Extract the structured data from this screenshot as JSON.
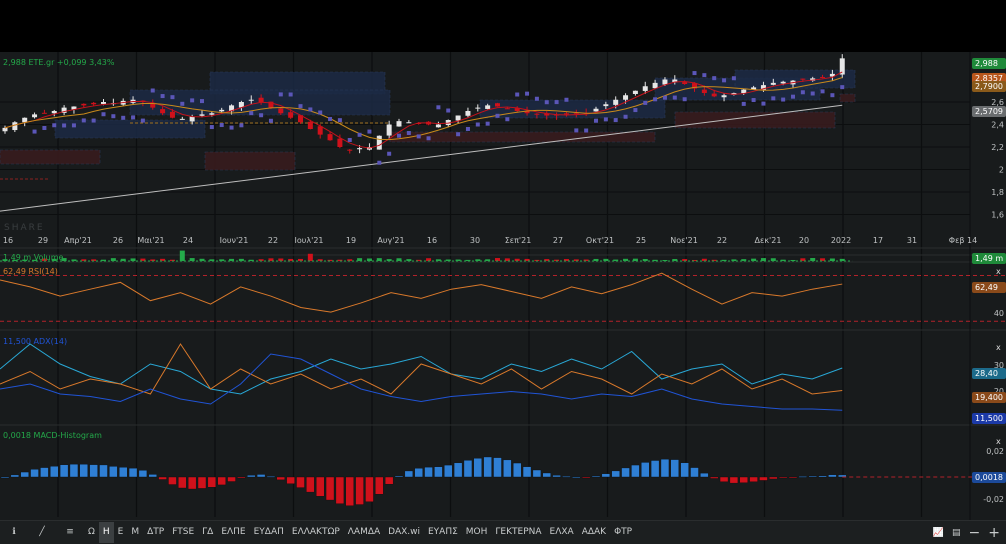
{
  "header": {
    "price": "2,988",
    "symbol": "ETE.gr",
    "change": "+0,099",
    "change_pct": "3,43%"
  },
  "watermark": "SHARE",
  "colors": {
    "up": "#e6e6e6",
    "down": "#d0111b",
    "green": "#24a94a",
    "rsi": "#d9792b",
    "adx_plus": "#29a8d6",
    "adx_minus": "#d9792b",
    "adx": "#2054d6",
    "sar": "#5b56b8",
    "macd_up": "#2f7fd4",
    "macd_down": "#d0111b"
  },
  "right_axis": {
    "price_badges": [
      "2,988",
      "2,8357",
      "2,7900",
      "2,5709"
    ],
    "price_ticks": [
      "2,6",
      "2,4",
      "2,2",
      "2",
      "1,8",
      "1,6"
    ],
    "volume_badge": "1,49 m",
    "rsi_badge": "62,49",
    "rsi_tick": "40",
    "adx_ticks": [
      "30",
      "20"
    ],
    "adx_badges": [
      "28,40",
      "19,400",
      "11,500"
    ],
    "macd_ticks": [
      "0,02",
      "-0,02"
    ],
    "macd_badge": "0,0018",
    "close_label": "x"
  },
  "panels": {
    "volume_label": "1,49 m Volume",
    "rsi_label": "62,49 RSI(14)",
    "adx_label": "11,500 ADX(14)",
    "macd_label": "0,0018 MACD-Histogram"
  },
  "chart_data": {
    "type": "candlestick",
    "title": "ETE.gr",
    "x_tick_labels": [
      "16",
      "29",
      "Απρ'21",
      "26",
      "Μαι'21",
      "24",
      "Ιουν'21",
      "22",
      "Ιουλ'21",
      "19",
      "Αυγ'21",
      "16",
      "30",
      "Σεπ'21",
      "27",
      "Οκτ'21",
      "25",
      "Νοε'21",
      "22",
      "Δεκ'21",
      "20",
      "2022",
      "17",
      "31",
      "Φεβ 14"
    ],
    "ylim": [
      1.5,
      3.0
    ],
    "closes": [
      2.37,
      2.42,
      2.46,
      2.49,
      2.5,
      2.52,
      2.55,
      2.56,
      2.57,
      2.58,
      2.6,
      2.59,
      2.61,
      2.62,
      2.6,
      2.55,
      2.5,
      2.46,
      2.45,
      2.47,
      2.49,
      2.5,
      2.53,
      2.57,
      2.6,
      2.62,
      2.6,
      2.55,
      2.5,
      2.46,
      2.42,
      2.36,
      2.31,
      2.26,
      2.2,
      2.17,
      2.19,
      2.2,
      2.3,
      2.4,
      2.43,
      2.42,
      2.41,
      2.4,
      2.4,
      2.44,
      2.48,
      2.52,
      2.55,
      2.57,
      2.56,
      2.54,
      2.52,
      2.5,
      2.49,
      2.48,
      2.48,
      2.49,
      2.5,
      2.5,
      2.54,
      2.58,
      2.62,
      2.66,
      2.7,
      2.74,
      2.77,
      2.8,
      2.8,
      2.76,
      2.72,
      2.68,
      2.65,
      2.66,
      2.68,
      2.71,
      2.73,
      2.75,
      2.77,
      2.78,
      2.79,
      2.8,
      2.81,
      2.82,
      2.85,
      2.988
    ],
    "long_ma": {
      "start": 1.63,
      "end": 2.5709
    },
    "rsi": {
      "ylim": [
        25,
        80
      ],
      "levels": [
        70,
        30
      ],
      "values": [
        66,
        60,
        52,
        58,
        64,
        48,
        55,
        45,
        60,
        52,
        42,
        38,
        46,
        55,
        50,
        58,
        62,
        56,
        50,
        60,
        54,
        62,
        72,
        58,
        45,
        55,
        52,
        58,
        62.49
      ]
    },
    "adx": {
      "ylim": [
        6,
        42
      ],
      "series": [
        {
          "name": "+DI",
          "values": [
            28,
            38,
            30,
            25,
            22,
            30,
            27,
            20,
            18,
            24,
            27,
            32,
            28,
            30,
            33,
            26,
            24,
            30,
            27,
            32,
            28,
            35,
            24,
            28,
            30,
            22,
            26,
            24,
            28.4
          ]
        },
        {
          "name": "-DI",
          "values": [
            22,
            27,
            20,
            24,
            22,
            18,
            38,
            20,
            28,
            22,
            26,
            20,
            24,
            18,
            30,
            26,
            22,
            28,
            20,
            27,
            24,
            18,
            26,
            22,
            28,
            20,
            24,
            18,
            19.4
          ]
        },
        {
          "name": "ADX",
          "values": [
            20,
            22,
            18,
            17,
            15,
            20,
            16,
            14,
            22,
            34,
            32,
            26,
            20,
            17,
            15,
            17,
            18,
            19,
            18,
            16,
            18,
            17,
            20,
            16,
            14,
            13,
            12,
            12,
            11.5
          ]
        }
      ]
    },
    "macd_hist": {
      "ylim": [
        -0.03,
        0.03
      ],
      "last": 0.0018
    }
  },
  "toolbar": {
    "items": [
      "Ω",
      "Η",
      "Ε",
      "Μ",
      "ΔΤΡ",
      "FTSE",
      "ΓΔ",
      "ΕΛΠΕ",
      "ΕΥΔΑΠ",
      "ΕΛΛΑΚΤΩΡ",
      "ΛΑΜΔΑ",
      "DAX.wi",
      "ΕΥΑΠΣ",
      "ΜΟΗ",
      "ΓΕΚΤΕΡΝΑ",
      "ΕΛΧΑ",
      "ΑΔΑΚ",
      "ΦΤΡ"
    ],
    "active": "Η"
  }
}
